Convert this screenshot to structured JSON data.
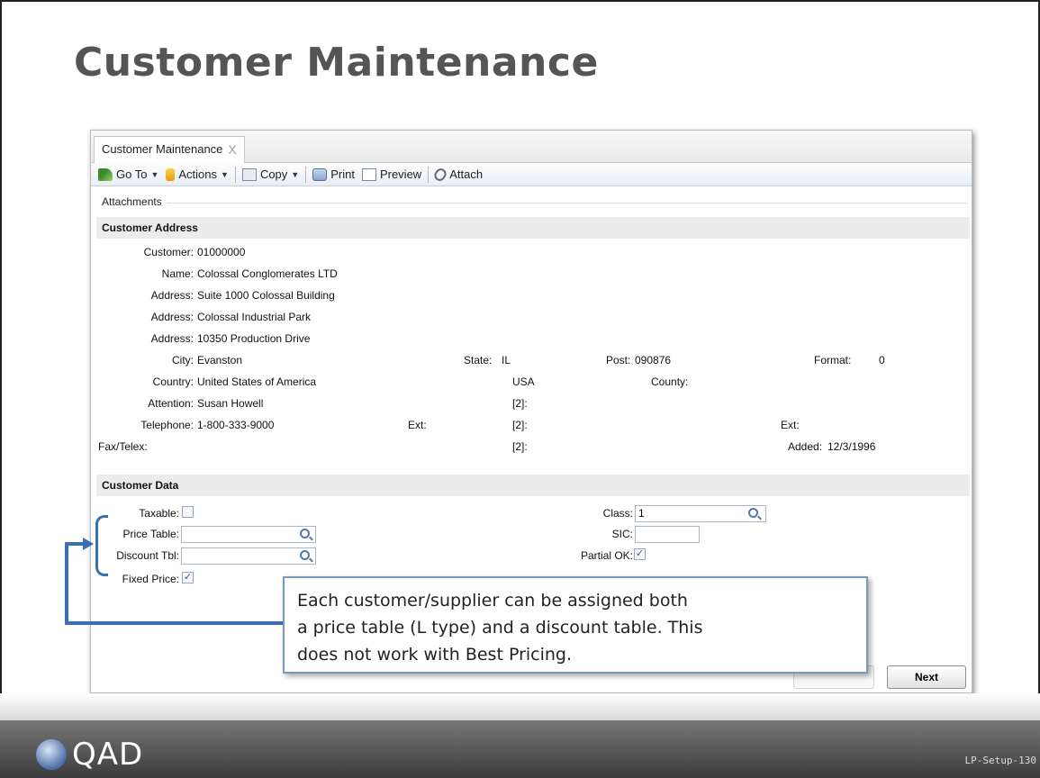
{
  "slide": {
    "title": "Customer Maintenance",
    "logo_text": "QAD",
    "slide_id": "LP-Setup-130"
  },
  "window": {
    "tab_label": "Customer Maintenance",
    "tab_close": "X",
    "toolbar": {
      "goto_label": "Go To",
      "actions_label": "Actions",
      "copy_label": "Copy",
      "print_label": "Print",
      "preview_label": "Preview",
      "attach_label": "Attach",
      "caret": "▼"
    },
    "attachments_label": "Attachments"
  },
  "address": {
    "section_title": "Customer Address",
    "customer_label": "Customer:",
    "customer_value": "01000000",
    "name_label": "Name:",
    "name_value": "Colossal Conglomerates LTD",
    "address_label": "Address:",
    "address1": "Suite 1000 Colossal Building",
    "address2": "Colossal Industrial Park",
    "address3": "10350 Production Drive",
    "city_label": "City:",
    "city_value": "Evanston",
    "state_label": "State:",
    "state_value": "IL",
    "post_label": "Post:",
    "post_value": "090876",
    "format_label": "Format:",
    "format_value": "0",
    "country_label": "Country:",
    "country_value": "United States of America",
    "country_code": "USA",
    "county_label": "County:",
    "attention_label": "Attention:",
    "attention_value": "Susan Howell",
    "attention_2": "[2]:",
    "telephone_label": "Telephone:",
    "telephone_value": "1-800-333-9000",
    "ext_label": "Ext:",
    "telephone_2": "[2]:",
    "ext2_label": "Ext:",
    "fax_label": "Fax/Telex:",
    "fax_2": "[2]:",
    "added_label": "Added:",
    "added_value": "12/3/1996"
  },
  "customer_data": {
    "section_title": "Customer Data",
    "taxable_label": "Taxable:",
    "taxable_checked": false,
    "price_table_label": "Price Table:",
    "price_table_value": "",
    "discount_tbl_label": "Discount Tbl:",
    "discount_tbl_value": "",
    "fixed_price_label": "Fixed Price:",
    "fixed_price_checked": true,
    "class_label": "Class:",
    "class_value": "1",
    "sic_label": "SIC:",
    "sic_value": "",
    "partial_ok_label": "Partial OK:",
    "partial_ok_checked": true,
    "check_mark": "✓"
  },
  "buttons": {
    "next_label": "Next"
  },
  "callout": {
    "line1": "Each customer/supplier can be assigned both",
    "line2": "a price table (L type) and a discount table. This",
    "line3": "does not work with Best Pricing."
  },
  "colors": {
    "accent_blue": "#3a6fb0",
    "title_gray": "#555555"
  }
}
